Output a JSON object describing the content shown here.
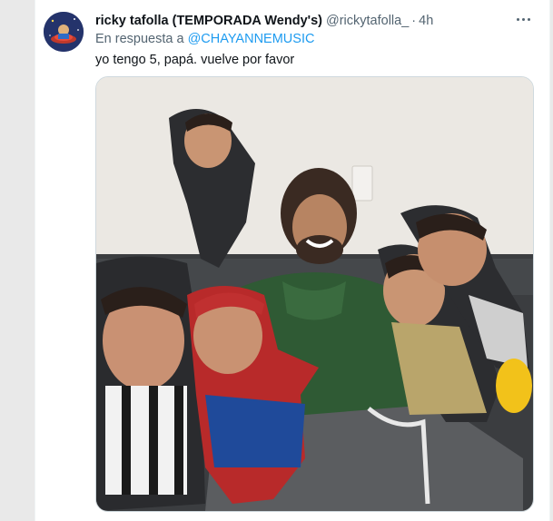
{
  "tweet": {
    "display_name": "ricky tafolla (TEMPORADA Wendy's)",
    "handle": "@rickytafolla_",
    "separator": "·",
    "time": "4h",
    "reply_prefix": "En respuesta a",
    "reply_mention": "@CHAYANNEMUSIC",
    "text": "yo tengo 5, papá. vuelve por favor"
  },
  "colors": {
    "link": "#1d9bf0",
    "secondary_text": "#536471",
    "primary_text": "#0f1419"
  },
  "icons": {
    "more": "more-horizontal-icon"
  }
}
